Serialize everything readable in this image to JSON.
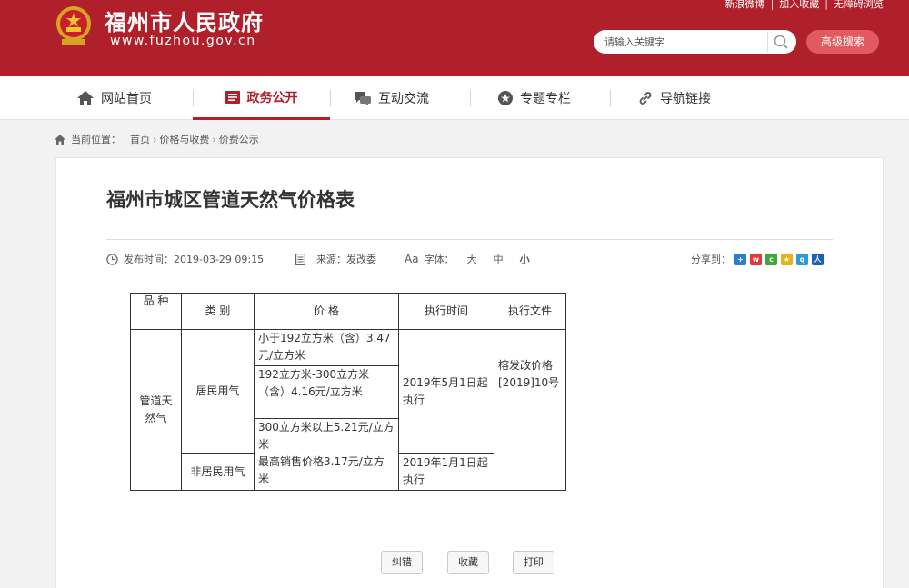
{
  "header": {
    "site_title": "福州市人民政府",
    "site_url": "www.fuzhou.gov.cn",
    "top_links": [
      "新浪微博",
      "加入收藏",
      "无障碍浏览"
    ],
    "search_placeholder": "请输入关键字",
    "advanced_search_label": "高级搜索",
    "brand_color": "#b0202a"
  },
  "nav": {
    "items": [
      {
        "label": "网站首页",
        "icon": "home-icon"
      },
      {
        "label": "政务公开",
        "icon": "document-icon",
        "active": true
      },
      {
        "label": "互动交流",
        "icon": "chat-icon"
      },
      {
        "label": "专题专栏",
        "icon": "star-icon"
      },
      {
        "label": "导航链接",
        "icon": "link-icon"
      }
    ]
  },
  "breadcrumb": {
    "prefix": "当前位置：",
    "items": [
      "首页",
      "价格与收费",
      "价费公示"
    ]
  },
  "article": {
    "title": "福州市城区管道天然气价格表",
    "publish_label": "发布时间：",
    "publish_time": "2019-03-29 09:15",
    "source_label": "来源：",
    "source": "发改委",
    "font_label": "字体：",
    "font_sizes": [
      "大",
      "中",
      "小"
    ],
    "share_label": "分享到："
  },
  "table": {
    "headers": {
      "variety": "品 种",
      "category": "类 别",
      "price": "价 格",
      "exec_time": "执行时间",
      "exec_doc": "执行文件"
    },
    "variety": "管道天然气",
    "residential": "居民用气",
    "non_residential": "非居民用气",
    "tier1": "小于192立方米（含）3.47元/立方米",
    "tier2": "192立方米-300立方米（含）4.16元/立方米",
    "tier3": "300立方米以上5.21元/立方米",
    "non_res_price": "最高销售价格3.17元/立方米",
    "res_time": "2019年5月1日起执行",
    "non_res_time": "2019年1月1日起执行",
    "doc": "榕发改价格[2019]10号"
  },
  "actions": {
    "correct": "纠错",
    "favorite": "收藏",
    "print": "打印"
  }
}
